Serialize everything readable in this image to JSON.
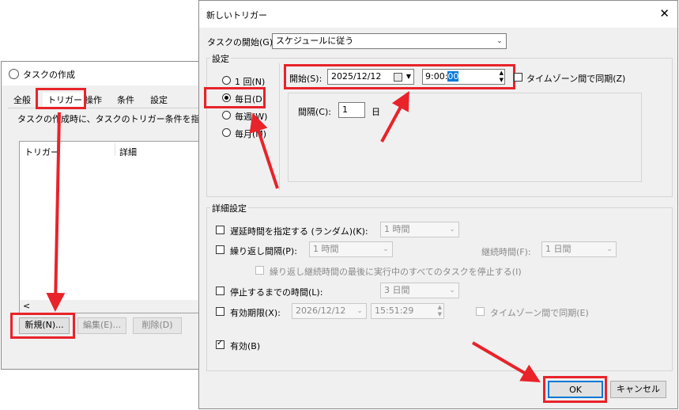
{
  "back_window": {
    "title": "タスクの作成",
    "tabs": [
      "全般",
      "トリガー",
      "操作",
      "条件",
      "設定"
    ],
    "description": "タスクの作成時に、タスクのトリガー条件を指定で",
    "columns": [
      "トリガー",
      "詳細"
    ],
    "scroll_left": "<",
    "buttons": {
      "new": "新規(N)...",
      "edit": "編集(E)...",
      "delete": "削除(D)"
    }
  },
  "dialog": {
    "title": "新しいトリガー",
    "close": "✕",
    "begin_task_label": "タスクの開始(G):",
    "begin_task_value": "スケジュールに従う",
    "settings_group": "設定",
    "schedule_options": [
      "1 回(N)",
      "毎日(D)",
      "毎週(W)",
      "毎月(M)"
    ],
    "selected_schedule": 1,
    "start_label": "開始(S):",
    "start_date": "2025/12/12",
    "start_time": "9:00:00",
    "start_time_prefix": "9:00:",
    "start_time_selected": "00",
    "sync_timezone_label": "タイムゾーン間で同期(Z)",
    "interval_label": "間隔(C):",
    "interval_value": "1",
    "interval_unit": "日",
    "advanced_group": "詳細設定",
    "delay_label": "遅延時間を指定する (ランダム)(K):",
    "delay_value": "1 時間",
    "repeat_label": "繰り返し間隔(P):",
    "repeat_value": "1 時間",
    "duration_label": "継続時間(F):",
    "duration_value": "1 日間",
    "stop_all_label": "繰り返し継続時間の最後に実行中のすべてのタスクを停止する(I)",
    "stop_after_label": "停止するまでの時間(L):",
    "stop_after_value": "3 日間",
    "expire_label": "有効期限(X):",
    "expire_date": "2026/12/12",
    "expire_time": "15:51:29",
    "expire_sync_label": "タイムゾーン間で同期(E)",
    "enabled_label": "有効(B)",
    "ok": "OK",
    "cancel": "キャンセル"
  },
  "colors": {
    "annotation_red": "#e8232a",
    "selection_blue": "#0078d7"
  }
}
